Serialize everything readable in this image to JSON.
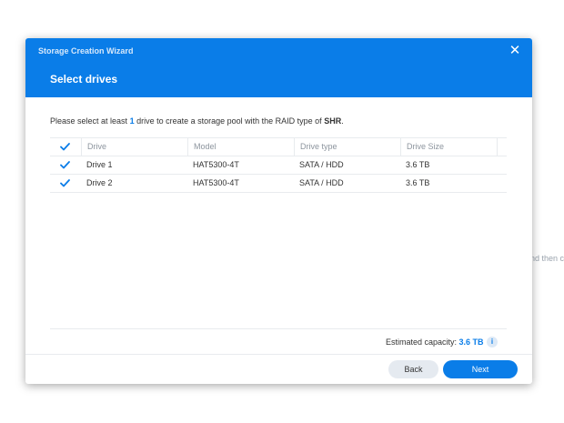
{
  "background": {
    "partial_text": "nd then c"
  },
  "dialog": {
    "wizard_title": "Storage Creation Wizard",
    "close_glyph": "✕",
    "step_title": "Select drives",
    "instructions": {
      "prefix": "Please select at least ",
      "count": "1",
      "middle": " drive to create a storage pool with the RAID type of ",
      "raid_type": "SHR",
      "suffix": "."
    },
    "table": {
      "columns": [
        "Drive",
        "Model",
        "Drive type",
        "Drive Size"
      ],
      "header_checked": true,
      "rows": [
        {
          "checked": true,
          "drive": "Drive 1",
          "model": "HAT5300-4T",
          "type": "SATA / HDD",
          "size": "3.6 TB"
        },
        {
          "checked": true,
          "drive": "Drive 2",
          "model": "HAT5300-4T",
          "type": "SATA / HDD",
          "size": "3.6 TB"
        }
      ]
    },
    "capacity": {
      "label": "Estimated capacity: ",
      "value": "3.6 TB",
      "info_icon": "info-icon"
    },
    "buttons": {
      "back": "Back",
      "next": "Next"
    }
  },
  "colors": {
    "accent": "#0a7de8",
    "header_bg": "#0a7de8",
    "back_button_bg": "#e5eaf0"
  }
}
